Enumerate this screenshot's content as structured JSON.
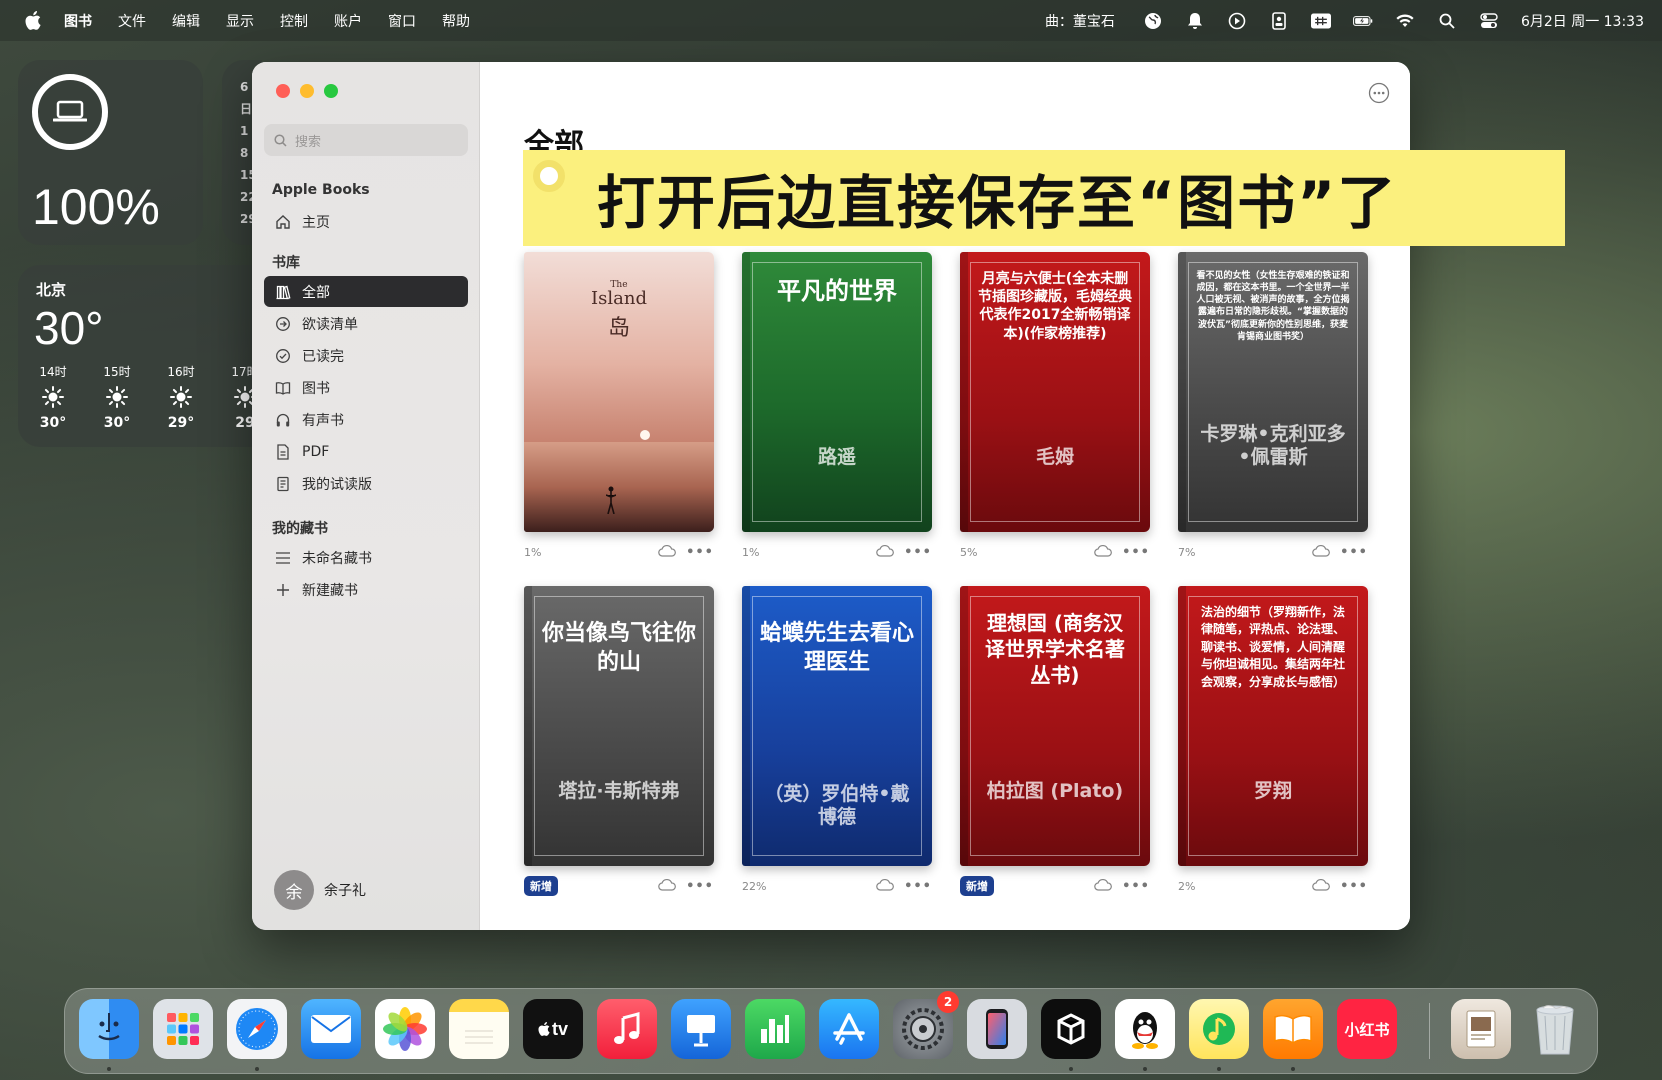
{
  "menubar": {
    "app_name": "图书",
    "items": [
      "文件",
      "编辑",
      "显示",
      "控制",
      "账户",
      "窗口",
      "帮助"
    ],
    "now_playing": "曲：董宝石",
    "clock": "6月2日 周一  13:33"
  },
  "widgets": {
    "battery": {
      "percent": "100%"
    },
    "calendar": {
      "lines": [
        "6",
        "日",
        "1",
        "8",
        "15",
        "22",
        "29"
      ]
    },
    "weather": {
      "city": "北京",
      "temp": "30°",
      "hours": [
        {
          "time": "14时",
          "temp": "30°"
        },
        {
          "time": "15时",
          "temp": "30°"
        },
        {
          "time": "16时",
          "temp": "29°"
        },
        {
          "time": "17时",
          "temp": "29"
        }
      ]
    }
  },
  "sidebar": {
    "search_placeholder": "搜索",
    "apple_books_header": "Apple Books",
    "home_label": "主页",
    "library_header": "书库",
    "library_items": [
      "全部",
      "欲读清单",
      "已读完",
      "图书",
      "有声书",
      "PDF",
      "我的试读版"
    ],
    "collections_header": "我的藏书",
    "collection_items": [
      "未命名藏书",
      "新建藏书"
    ],
    "user": {
      "avatar_letter": "余",
      "name": "余子礼"
    }
  },
  "main": {
    "title": "全部",
    "books": [
      {
        "title": "平凡的世界",
        "author": "路遥",
        "progress": "1%"
      },
      {
        "title": "月亮与六便士(全本未删节插图珍藏版，毛姆经典代表作2017全新畅销译本)(作家榜推荐)",
        "author": "毛姆",
        "progress": "5%"
      },
      {
        "title": "看不见的女性（女性生存艰难的铁证和成因，都在这本书里。一个全世界一半人口被无视、被消声的故事，全方位揭露遍布日常的隐形歧视。“掌握数据的波伏瓦”彻底更新你的性别思维，获麦肯锡商业图书奖）",
        "author": "卡罗琳•克利亚多•佩雷斯",
        "progress": "7%"
      },
      {
        "title": "你当像鸟飞往你的山",
        "author": "塔拉·韦斯特弗",
        "progress": "新增"
      },
      {
        "title": "蛤蟆先生去看心理医生",
        "author": "（英）罗伯特•戴博德",
        "progress": "22%"
      },
      {
        "title": "理想国 (商务汉译世界学术名著丛书)",
        "author": "柏拉图 (Plato)",
        "progress": "新增"
      },
      {
        "title": "法治的细节（罗翔新作，法律随笔，评热点、论法理、聊读书、谈爱情，人间清醒与你坦诚相见。集结两年社会观察，分享成长与感悟）",
        "author": "罗翔",
        "progress": "2%"
      }
    ],
    "island_book": {
      "title_small": "The",
      "title_en": "Island",
      "title_cn": "岛",
      "progress": "1%"
    }
  },
  "overlay": {
    "banner_text": "打开后边直接保存至“图书”了"
  },
  "dock": {
    "apps": [
      "finder-icon",
      "launchpad-icon",
      "safari-icon",
      "mail-icon",
      "photos-icon",
      "notes-icon",
      "apple-tv-icon",
      "music-icon",
      "keynote-icon",
      "numbers-icon",
      "app-store-icon",
      "system-settings-icon",
      "iphone-mirroring-icon",
      "capcut-icon",
      "qq-icon",
      "qq-music-icon",
      "books-icon",
      "xiaohongshu-icon",
      "preview-icon",
      "trash-icon"
    ],
    "tv_label": "tv",
    "xhs_label": "小红书",
    "settings_badge": "2"
  }
}
